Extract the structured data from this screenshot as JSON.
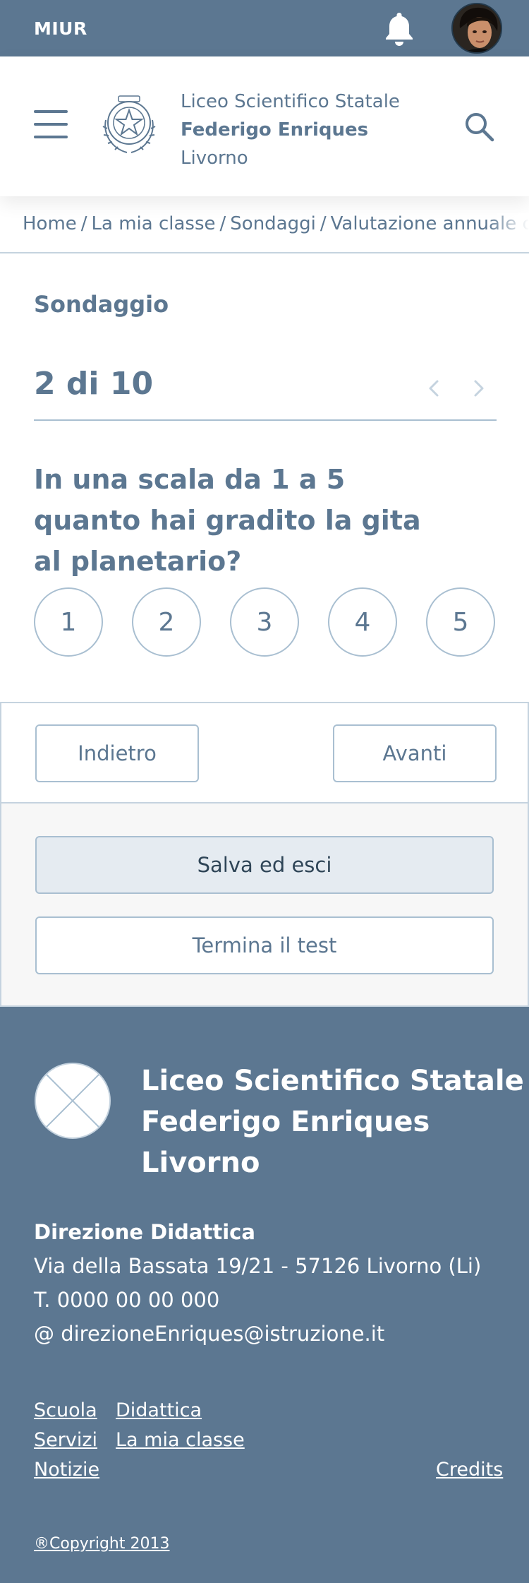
{
  "topbar": {
    "brand": "MIUR"
  },
  "header": {
    "school_line1": "Liceo Scientifico Statale",
    "school_line2": "Federigo Enriques",
    "school_line3": "Livorno"
  },
  "breadcrumb": [
    "Home",
    "La mia classe",
    "Sondaggi",
    "Valutazione annuale corso"
  ],
  "survey": {
    "label": "Sondaggio",
    "counter": "2 di 10",
    "question": "In una scala da 1 a 5 quanto hai gradito la gita al planetario?",
    "options": [
      "1",
      "2",
      "3",
      "4",
      "5"
    ]
  },
  "nav": {
    "back": "Indietro",
    "next": "Avanti"
  },
  "actions": {
    "save": "Salva ed esci",
    "end": "Termina il test"
  },
  "footer": {
    "title_line1": "Liceo Scientifico Statale",
    "title_line2": "Federigo Enriques",
    "title_line3": "Livorno",
    "direction_title": "Direzione Didattica",
    "address": "Via della Bassata 19/21 - 57126 Livorno (Li)",
    "phone": "T. 0000 00 00 000",
    "email": "@ direzioneEnriques@istruzione.it",
    "links": {
      "scuola": "Scuola",
      "didattica": "Didattica",
      "servizi": "Servizi",
      "la_mia_classe": "La mia classe",
      "notizie": "Notizie",
      "credits": "Credits"
    },
    "copyright": "®Copyright 2013"
  },
  "colors": {
    "primary": "#5c7791",
    "border": "#a9bfd1",
    "panel": "#f7f7f7",
    "save_bg": "#e5ebf1"
  }
}
